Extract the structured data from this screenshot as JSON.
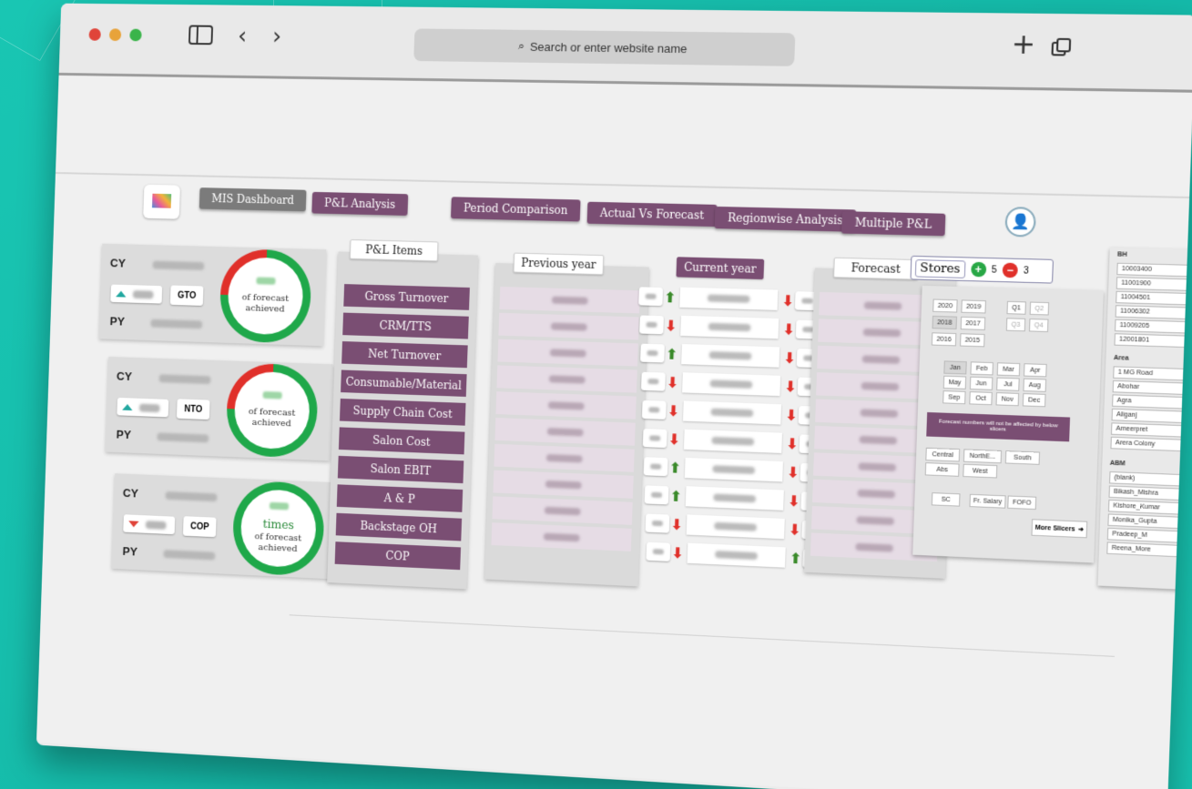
{
  "browser": {
    "search_placeholder": "Search or enter website name",
    "plus_icon": "+",
    "search_icon": "⌕"
  },
  "nav": {
    "items": [
      {
        "label": "MIS Dashboard",
        "active": true
      },
      {
        "label": "P&L Analysis",
        "active": false
      },
      {
        "label": "Period Comparison",
        "active": false
      },
      {
        "label": "Actual Vs Forecast",
        "active": false
      },
      {
        "label": "Regionwise Analysis",
        "active": false
      },
      {
        "label": "Multiple P&L",
        "active": false
      }
    ]
  },
  "kpis": [
    {
      "cy": "CY",
      "py": "PY",
      "tag": "GTO",
      "ring_line1": "of forecast",
      "ring_line2": "achieved",
      "trend": "up",
      "progress": 0.75
    },
    {
      "cy": "CY",
      "py": "PY",
      "tag": "NTO",
      "ring_line1": "of forecast",
      "ring_line2": "achieved",
      "trend": "up",
      "progress": 0.75
    },
    {
      "cy": "CY",
      "py": "PY",
      "tag": "COP",
      "ring_big": "times",
      "ring_line1": "of forecast",
      "ring_line2": "achieved",
      "trend": "down",
      "progress": 1.0
    }
  ],
  "columns": {
    "pl_items": "P&L Items",
    "previous_year": "Previous year",
    "current_year": "Current year",
    "forecast": "Forecast"
  },
  "pl_items": [
    "Gross Turnover",
    "CRM/TTS",
    "Net Turnover",
    "Consumable/Material",
    "Supply Chain Cost",
    "Salon Cost",
    "Salon EBIT",
    "A & P",
    "Backstage OH",
    "COP"
  ],
  "cy_arrows": [
    [
      "up",
      "down"
    ],
    [
      "down",
      "down"
    ],
    [
      "up",
      "down"
    ],
    [
      "down",
      "down"
    ],
    [
      "down",
      "down"
    ],
    [
      "down",
      "down"
    ],
    [
      "up",
      "down"
    ],
    [
      "up",
      "down"
    ],
    [
      "down",
      "down"
    ],
    [
      "down",
      "up"
    ]
  ],
  "stores": {
    "label": "Stores",
    "plus_count": "5",
    "minus_count": "3"
  },
  "filters": {
    "years": [
      "2020",
      "2019",
      "2018",
      "2017",
      "2016",
      "2015"
    ],
    "quarters": [
      "Q1",
      "Q2",
      "Q3",
      "Q4"
    ],
    "months": [
      "Jan",
      "Feb",
      "Mar",
      "Apr",
      "May",
      "Jun",
      "Jul",
      "Aug",
      "Sep",
      "Oct",
      "Nov",
      "Dec"
    ],
    "note": "Forecast numbers will not be affected by below slicers",
    "regions": [
      "Central",
      "NorthE...",
      "South",
      "Abs",
      "West"
    ],
    "types": [
      "SC",
      "Fr. Salary",
      "FOFO"
    ],
    "more": "More Slicers"
  },
  "side": {
    "bh_title": "BH",
    "bh_items": [
      "10003400",
      "11001900",
      "11004501",
      "11006302",
      "11009205",
      "12001801"
    ],
    "area_title": "Area",
    "area_items": [
      "1 MG Road",
      "Abohar",
      "Agra",
      "Aliganj",
      "Ameerpret",
      "Arera Colony"
    ],
    "abm_title": "ABM",
    "abm_items": [
      "(blank)",
      "Bikash_Mishra",
      "Kishore_Kumar",
      "Monika_Gupta",
      "Pradeep_M",
      "Reena_More"
    ]
  },
  "colors": {
    "purple": "#7a4e73",
    "green": "#28a745",
    "red": "#e0302a",
    "teal": "#19c6b3"
  }
}
